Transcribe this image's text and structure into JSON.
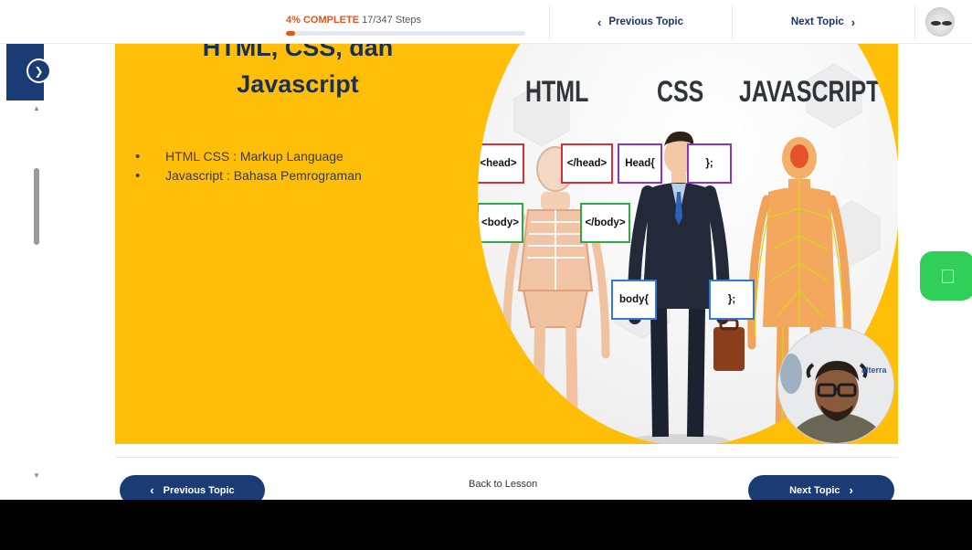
{
  "topbar": {
    "progress_percent_label": "4% COMPLETE",
    "progress_steps": "17/347 Steps",
    "progress_value": 0.04,
    "prev_topic_label": "Previous Topic",
    "next_topic_label": "Next Topic"
  },
  "slide": {
    "title": "HTML, CSS, dan Javascript",
    "bullets": [
      "HTML CSS : Markup Language",
      "Javascript : Bahasa Pemrograman"
    ],
    "words": {
      "html": "HTML",
      "css": "CSS",
      "js": "JAVASCRIPT"
    },
    "code_boxes": [
      "<head>",
      "</head>",
      "Head{",
      "};",
      "<body>",
      "</body>",
      "body{",
      "};"
    ]
  },
  "webcam": {
    "brand": "alterra"
  },
  "footer": {
    "prev_topic_label": "Previous Topic",
    "back_to_lesson": "Back to Lesson",
    "next_topic_label": "Next Topic"
  },
  "icons": {
    "sidebar_toggle": "chevron-right-icon",
    "prev": "chevron-left-icon",
    "next": "chevron-right-icon",
    "float": "chat-icon"
  },
  "colors": {
    "brand_navy": "#1b3b74",
    "accent_orange": "#e2561b",
    "slide_yellow": "#ffbe08",
    "float_green": "#2fcf58"
  }
}
